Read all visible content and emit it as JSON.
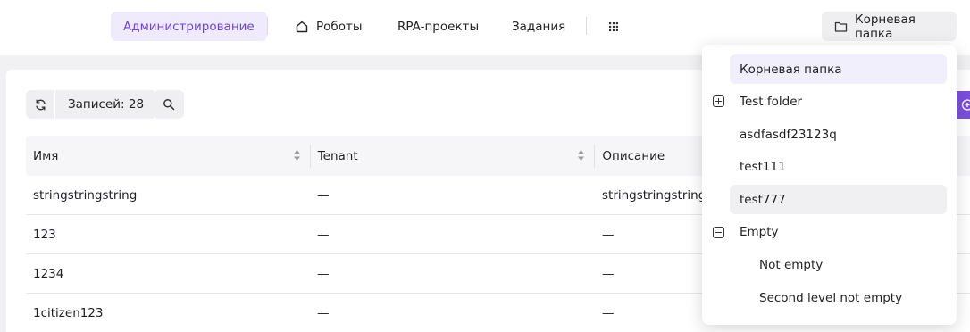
{
  "nav": {
    "admin": "Администрирование",
    "robots": "Роботы",
    "rpa_projects": "RPA-проекты",
    "tasks": "Задания",
    "folder_button": "Корневая папка"
  },
  "toolbar": {
    "records_label": "Записей: 28"
  },
  "table": {
    "columns": [
      "Имя",
      "Tenant",
      "Описание"
    ],
    "rows": [
      [
        "stringstringstring",
        "—",
        "stringstringstring"
      ],
      [
        "123",
        "—",
        "—"
      ],
      [
        "1234",
        "—",
        "—"
      ],
      [
        "1citizen123",
        "—",
        "—"
      ]
    ]
  },
  "folder_dropdown": {
    "items": [
      {
        "label": "Корневая папка",
        "state": "selected"
      },
      {
        "label": "Test folder",
        "toggle": "expand"
      },
      {
        "label": "asdfasdf23123q"
      },
      {
        "label": "test111"
      },
      {
        "label": "test777",
        "state": "hover"
      },
      {
        "label": "Empty",
        "toggle": "collapse"
      },
      {
        "label": "Not empty",
        "level": 2
      },
      {
        "label": "Second level not empty",
        "level": 2
      }
    ]
  },
  "colors": {
    "accent": "#6b46d8",
    "accent_bg": "#efebfd",
    "button_bg": "#efeff1",
    "page_bg": "#f1f1f3"
  },
  "icons": [
    "home-icon",
    "apps-grid-icon",
    "folder-icon",
    "refresh-icon",
    "search-icon",
    "sort-icon",
    "expand-icon",
    "collapse-icon",
    "add-icon"
  ]
}
